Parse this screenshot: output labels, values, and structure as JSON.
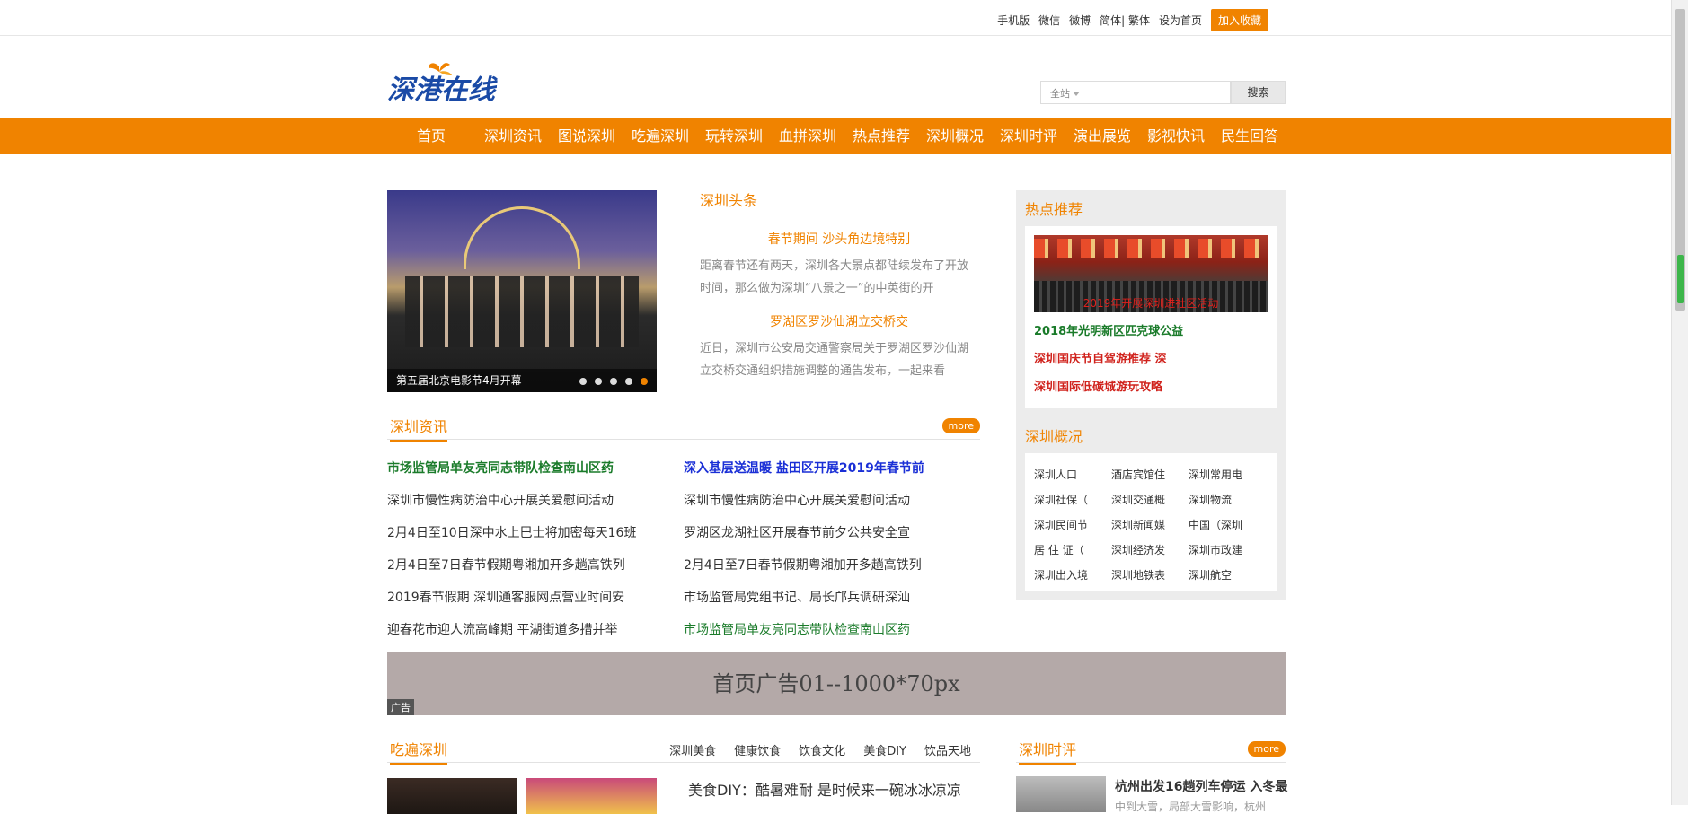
{
  "topbar": {
    "links": [
      "手机版",
      "微信",
      "微博",
      "简体| 繁体",
      "设为首页"
    ],
    "favorite_label": "加入收藏"
  },
  "logo": {
    "text": "深港在线"
  },
  "search": {
    "scope": "全站",
    "placeholder": "",
    "button_label": "搜索"
  },
  "nav": [
    "首页",
    "深圳资讯",
    "图说深圳",
    "吃遍深圳",
    "玩转深圳",
    "血拼深圳",
    "热点推荐",
    "深圳概况",
    "深圳时评",
    "演出展览",
    "影视快讯",
    "民生回答"
  ],
  "slider": {
    "caption": "第五届北京电影节4月开幕",
    "dots": 5,
    "active_dot": 5
  },
  "headlines": {
    "title": "深圳头条",
    "articles": [
      {
        "title": "春节期间 沙头角边境特别",
        "summary": "距离春节还有两天，深圳各大景点都陆续发布了开放时间，那么做为深圳“八景之一”的中英街的开"
      },
      {
        "title": "罗湖区罗沙仙湖立交桥交",
        "summary": "近日，深圳市公安局交通警察局关于罗湖区罗沙仙湖立交桥交通组织措施调整的通告发布，一起来看"
      }
    ]
  },
  "hot": {
    "title": "热点推荐",
    "image_caption": "2019年开展深圳进社区活动",
    "links": [
      "2018年光明新区匹克球公益",
      "深圳国庆节自驾游推荐 深",
      "深圳国际低碳城游玩攻略"
    ]
  },
  "overview": {
    "title": "深圳概况",
    "items": [
      "深圳人口",
      "酒店宾馆住",
      "深圳常用电",
      "深圳社保（",
      "深圳交通概",
      "深圳物流",
      "深圳民间节",
      "深圳新闻媒",
      "中国（深圳",
      "居 住 证（",
      "深圳经济发",
      "深圳市政建",
      "深圳出入境",
      "深圳地铁表",
      "深圳航空"
    ]
  },
  "news": {
    "title": "深圳资讯",
    "more": "more",
    "left": [
      "市场监管局单友亮同志带队检查南山区药",
      "深圳市慢性病防治中心开展关爱慰问活动",
      "2月4日至10日深中水上巴士将加密每天16班",
      "2月4日至7日春节假期粤湘加开多趟高铁列",
      "2019春节假期 深圳通客服网点营业时间安",
      "迎春花市迎人流高峰期 平湖街道多措并举"
    ],
    "right": [
      "深入基层送温暖 盐田区开展2019年春节前",
      "深圳市慢性病防治中心开展关爱慰问活动",
      "罗湖区龙湖社区开展春节前夕公共安全宣",
      "2月4日至7日春节假期粤湘加开多趟高铁列",
      "市场监管局党组书记、局长邝兵调研深汕",
      "市场监管局单友亮同志带队检查南山区药"
    ]
  },
  "ad": {
    "text": "首页广告01--1000*70px",
    "tag": "广告"
  },
  "food": {
    "title": "吃遍深圳",
    "tabs": [
      "深圳美食",
      "健康饮食",
      "饮食文化",
      "美食DIY",
      "饮品天地"
    ],
    "article": "美食DIY：酷暑难耐 是时候来一碗冰冰凉凉"
  },
  "review": {
    "title": "深圳时评",
    "more": "more",
    "article_title": "杭州出发16趟列车停运 入冬最",
    "article_summary": "中到大雪，局部大雪影响，杭州"
  }
}
